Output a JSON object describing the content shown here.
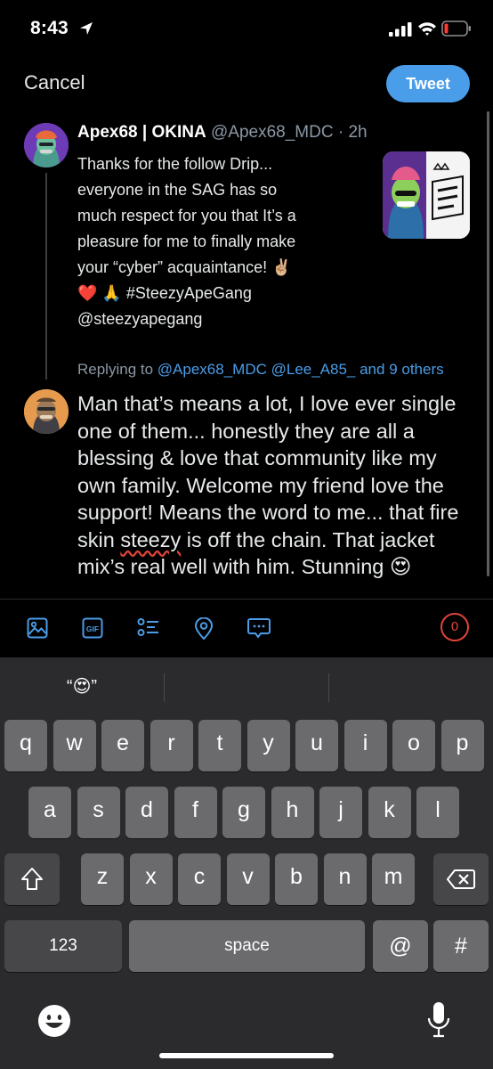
{
  "status_bar": {
    "time": "8:43"
  },
  "header": {
    "cancel_label": "Cancel",
    "tweet_label": "Tweet"
  },
  "original_tweet": {
    "display_name": "Apex68 | OKINA",
    "handle": "@Apex68_MDC",
    "age": "· 2h",
    "text_lines": [
      "Thanks for the follow Drip...",
      "everyone in the SAG has so",
      "much respect for you that It’s a",
      "pleasure for me to finally make",
      "your “cyber” acquaintance! ✌🏼",
      "❤️ 🙏 #SteezyApeGang",
      "@steezyapegang"
    ]
  },
  "replying": {
    "prefix": "Replying to",
    "mentions": "@Apex68_MDC @Lee_A85_ and 9 others"
  },
  "reply": {
    "text_before": "Man that’s means a lot, I love ever single one of them... honestly they are all a blessing & love that community like my own family. Welcome my friend love the support! Means the word to me... that fire skin ",
    "misspelled": "steezy",
    "text_after": " is off the chain. That jacket mix’s real well with him. Stunning 😍"
  },
  "toolbar": {
    "char_count": "0"
  },
  "keyboard": {
    "suggestion": "“😍”",
    "row1": [
      "q",
      "w",
      "e",
      "r",
      "t",
      "y",
      "u",
      "i",
      "o",
      "p"
    ],
    "row2": [
      "a",
      "s",
      "d",
      "f",
      "g",
      "h",
      "j",
      "k",
      "l"
    ],
    "row3": [
      "z",
      "x",
      "c",
      "v",
      "b",
      "n",
      "m"
    ],
    "numbers_key": "123",
    "space_key": "space",
    "at_key": "@",
    "hash_key": "#"
  },
  "colors": {
    "accent": "#4a9de8",
    "warning": "#e0433a",
    "background": "#000000",
    "keyboard": "#2b2b2d"
  }
}
